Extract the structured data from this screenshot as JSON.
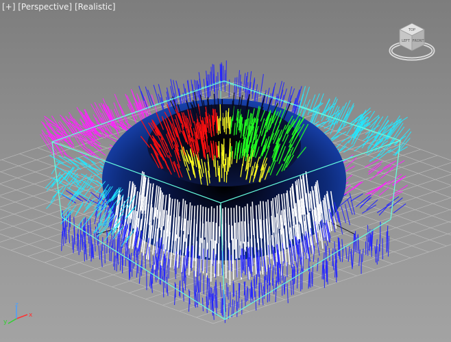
{
  "viewport": {
    "labels": {
      "plus": "[+]",
      "view": "[Perspective]",
      "shading": "[Realistic]"
    },
    "viewcube": {
      "top_face": "TOP",
      "left_face": "LEFT",
      "right_face": "FRONT"
    },
    "axes": {
      "x": "x",
      "y": "y",
      "z": "z"
    }
  },
  "colors": {
    "background": "#8f8f8f",
    "grid": "#c8c8c8",
    "bounding_box": "#66ffe0",
    "torus": "#0d2a78",
    "vectors_blue": "#2424ff",
    "vectors_magenta": "#ff22ff",
    "vectors_cyan": "#22e8ff",
    "vectors_white": "#ffffff",
    "vectors_red": "#ff1010",
    "vectors_green": "#22ff22",
    "vectors_yellow": "#ffff22",
    "axis_x": "#ff3030",
    "axis_y": "#30d030",
    "axis_z": "#4aa0ff"
  },
  "icons": [
    "viewcube-icon",
    "axis-tripod-icon"
  ]
}
